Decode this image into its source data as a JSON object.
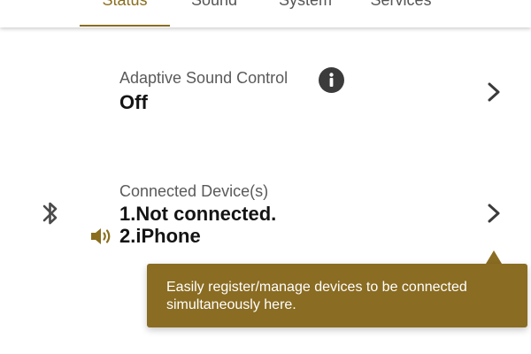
{
  "tabs": [
    {
      "label": "Status",
      "active": true
    },
    {
      "label": "Sound",
      "active": false
    },
    {
      "label": "System",
      "active": false
    },
    {
      "label": "Services",
      "active": false
    }
  ],
  "adaptive_sound_control": {
    "label": "Adaptive Sound Control",
    "value": "Off",
    "info_icon": "info-icon",
    "chevron_icon": "chevron-right-icon"
  },
  "connected_devices": {
    "label": "Connected Device(s)",
    "devices": [
      {
        "text": "1.Not connected.",
        "icon": "bluetooth-icon"
      },
      {
        "text": "2.iPhone",
        "icon": "speaker-icon"
      }
    ],
    "chevron_icon": "chevron-right-icon"
  },
  "tooltip": {
    "text": "Easily register/manage devices to be connected simultaneously here."
  },
  "colors": {
    "accent": "#8a6d1e",
    "tooltip_bg": "#8a6c22",
    "icon_dark": "#3b3b3b"
  }
}
